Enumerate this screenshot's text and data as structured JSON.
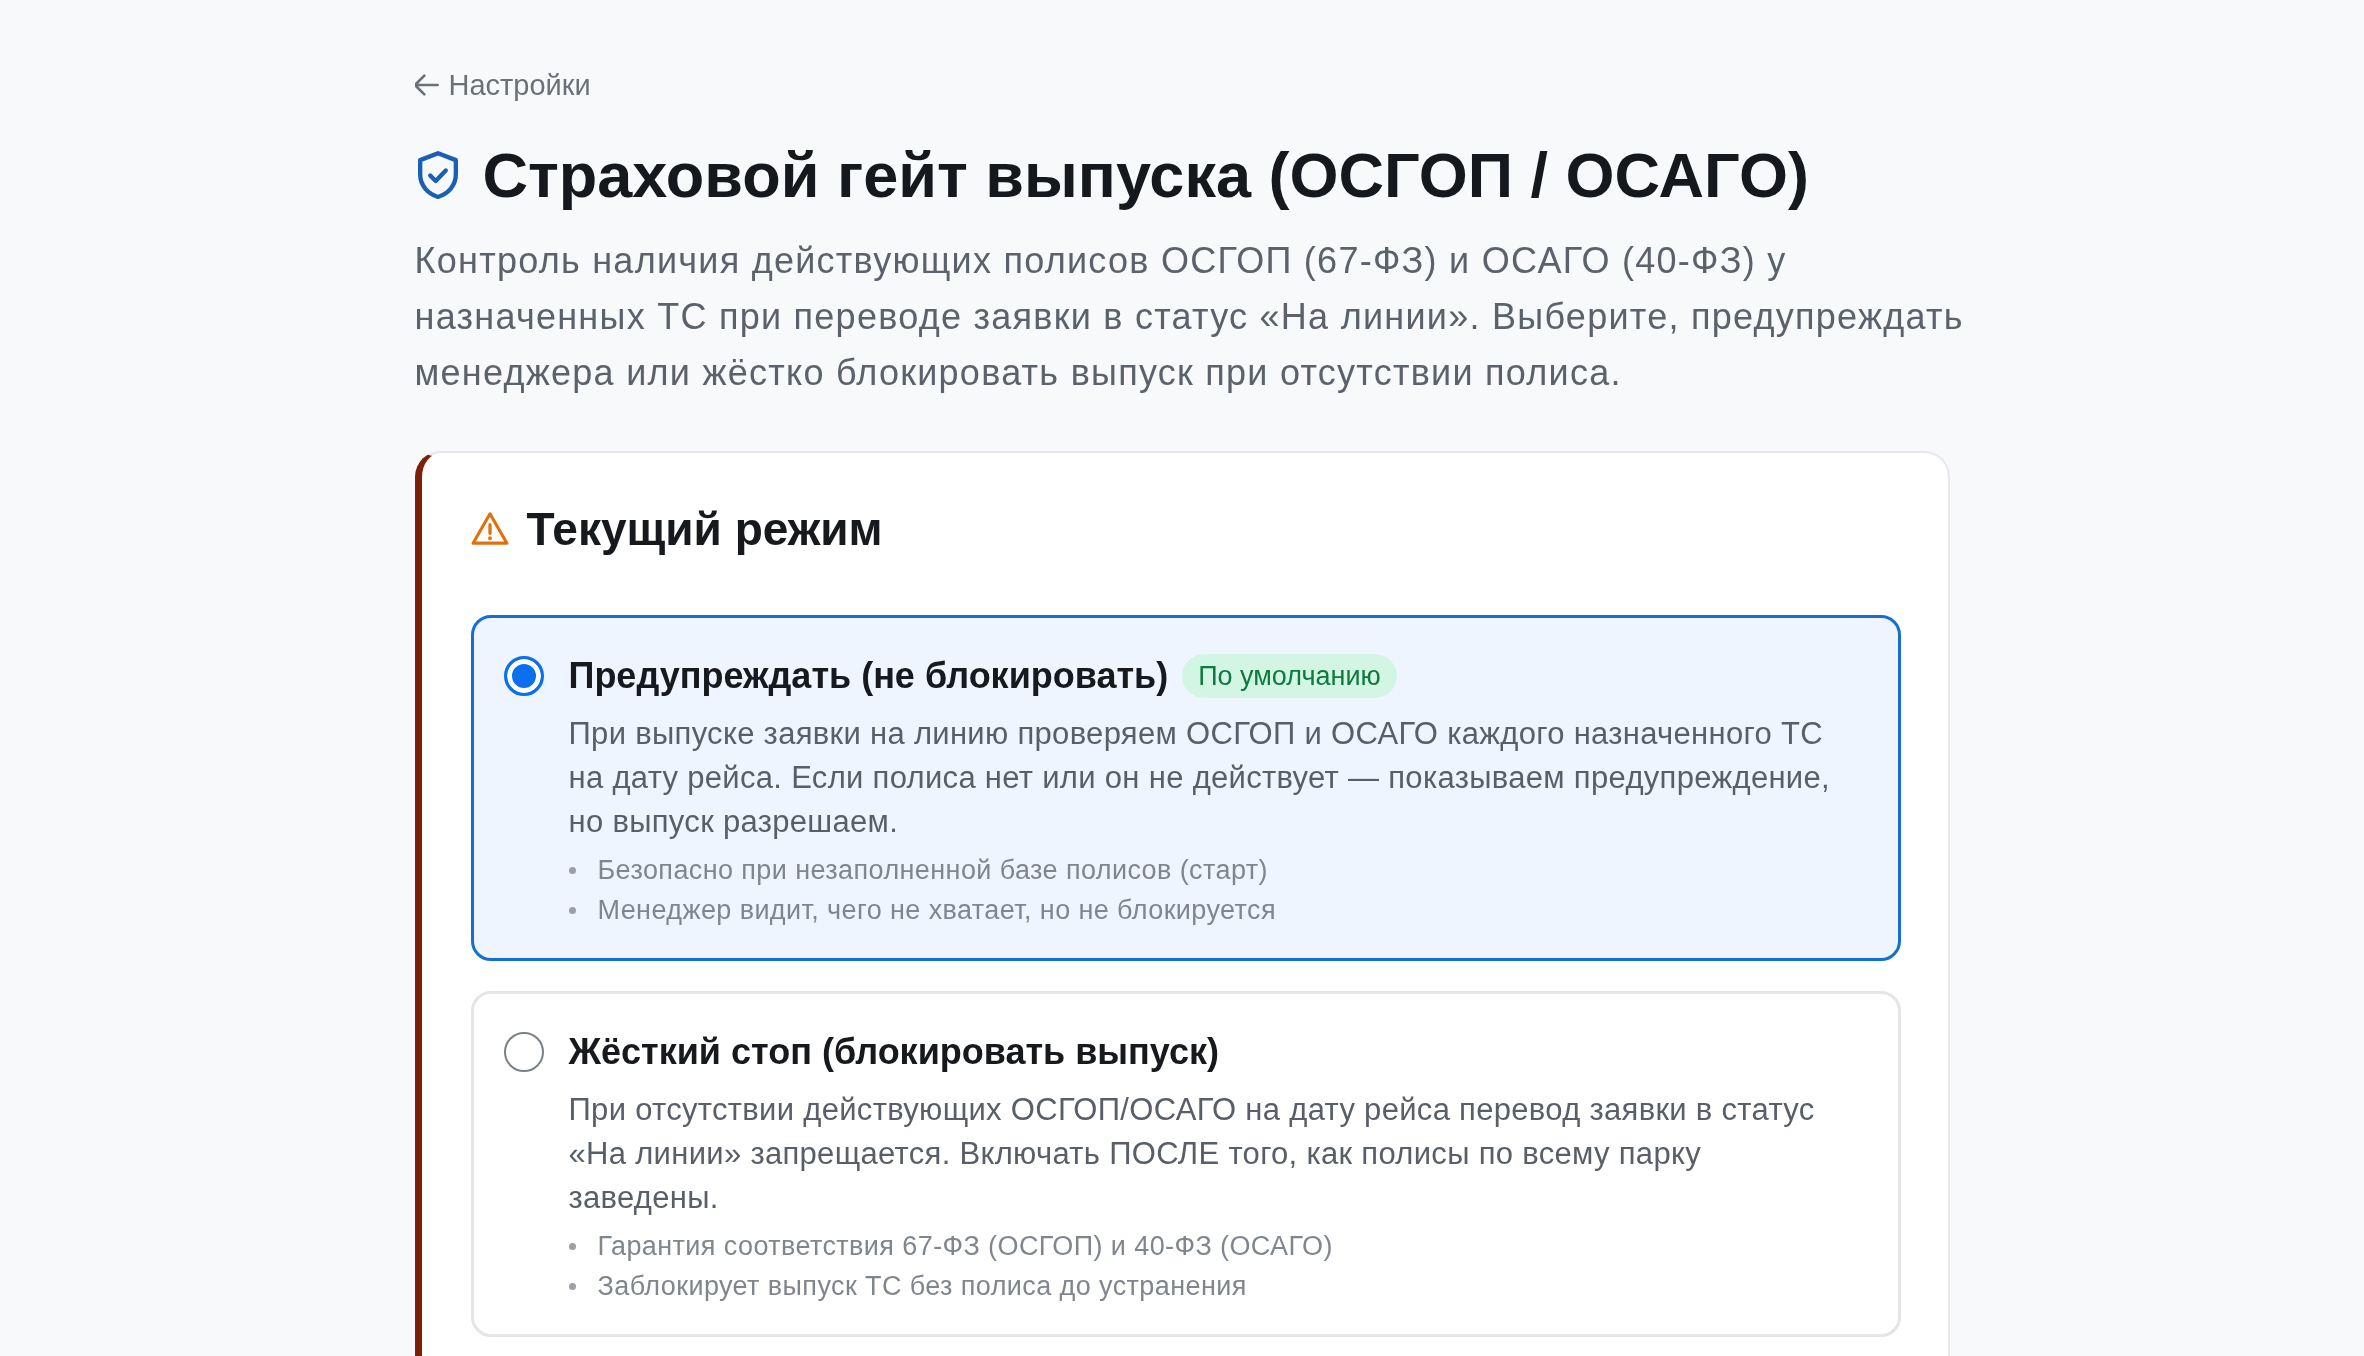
{
  "back_link": {
    "label": "Настройки"
  },
  "title": "Страховой гейт выпуска (ОСГОП / ОСАГО)",
  "description": "Контроль наличия действующих полисов ОСГОП (67-ФЗ) и ОСАГО (40-ФЗ) у назначенных ТС при переводе заявки в статус «На линии». Выберите, предупреждать менеджера или жёстко блокировать выпуск при отсутствии полиса.",
  "mode_card": {
    "title": "Текущий режим",
    "options": [
      {
        "label": "Предупреждать (не блокировать)",
        "badge": "По умолчанию",
        "selected": true,
        "description": "При выпуске заявки на линию проверяем ОСГОП и ОСАГО каждого назначенного ТС на дату рейса. Если полиса нет или он не действует — показываем предупреждение, но выпуск разрешаем.",
        "points": [
          "Безопасно при незаполненной базе полисов (старт)",
          "Менеджер видит, чего не хватает, но не блокируется"
        ]
      },
      {
        "label": "Жёсткий стоп (блокировать выпуск)",
        "selected": false,
        "description": "При отсутствии действующих ОСГОП/ОСАГО на дату рейса перевод заявки в статус «На линии» запрещается. Включать ПОСЛЕ того, как полисы по всему парку заведены.",
        "points": [
          "Гарантия соответствия 67-ФЗ (ОСГОП) и 40-ФЗ (ОСАГО)",
          "Заблокирует выпуск ТС без полиса до устранения"
        ]
      }
    ]
  }
}
